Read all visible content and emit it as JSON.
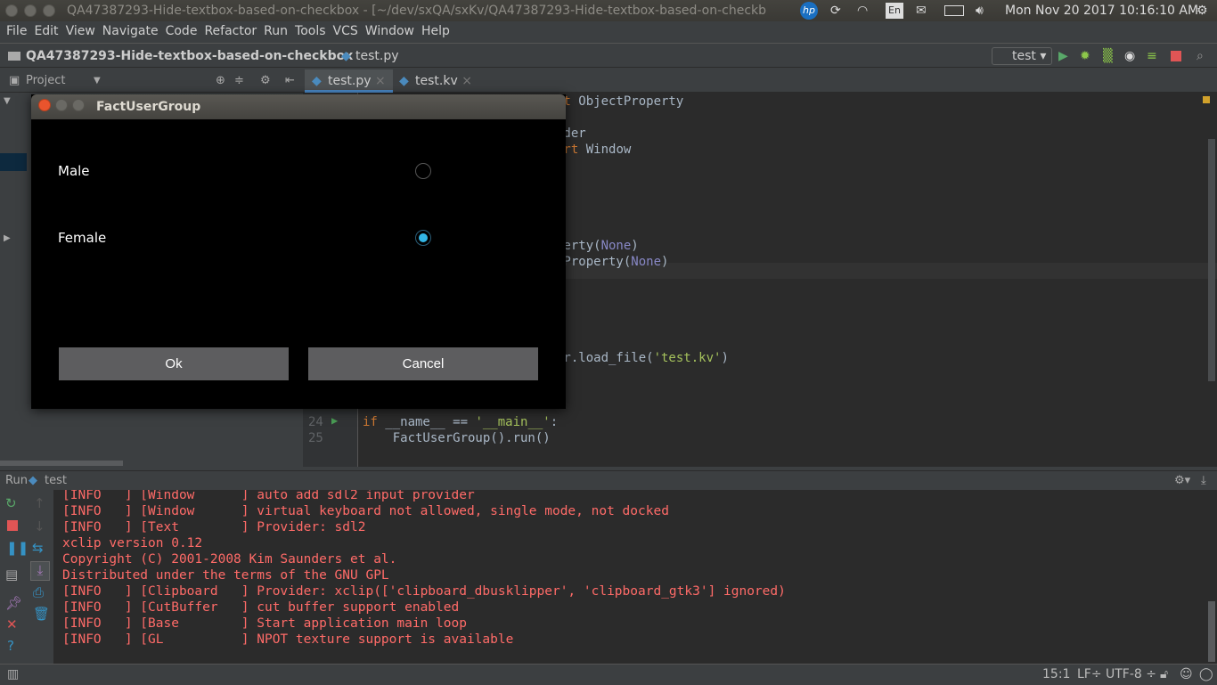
{
  "system": {
    "window_title": "QA47387293-Hide-textbox-based-on-checkbox - [~/dev/sxQA/sxKv/QA47387293-Hide-textbox-based-on-checkb",
    "keyboard": "En",
    "clock": "Mon Nov 20 2017 10:16:10 AM"
  },
  "menu": [
    "File",
    "Edit",
    "View",
    "Navigate",
    "Code",
    "Refactor",
    "Run",
    "Tools",
    "VCS",
    "Window",
    "Help"
  ],
  "nav": {
    "project": "QA47387293-Hide-textbox-based-on-checkbox",
    "file": "test.py",
    "run_config": "test"
  },
  "toolwindow": {
    "project_label": "Project"
  },
  "tabs": [
    {
      "label": "test.py",
      "active": true
    },
    {
      "label": "test.kv",
      "active": false
    }
  ],
  "code": {
    "l1a": "rt",
    "l1b": " ObjectProperty",
    "l2": "lder",
    "l3a": "ort",
    "l3b": " Window",
    "l4a": "perty(",
    "l4b": "None",
    "l4c": ")",
    "l5a": "tProperty(",
    "l5b": "None",
    "l5c": ")",
    "l6a": "er.load_file(",
    "l6b": "'test.kv'",
    "l6c": ")",
    "l24n": "24",
    "l24a": "if",
    "l24b": " __name__ == ",
    "l24c": "'__main__'",
    "l24d": ":",
    "l25n": "25",
    "l25": "    FactUserGroup().run()"
  },
  "dialog": {
    "title": "FactUserGroup",
    "options": [
      {
        "label": "Male",
        "selected": false
      },
      {
        "label": "Female",
        "selected": true
      }
    ],
    "ok": "Ok",
    "cancel": "Cancel",
    "accent": "#33b5e5"
  },
  "run": {
    "label": "Run",
    "config": "test"
  },
  "console": [
    "[INFO   ] [Window      ] auto add sdl2 input provider",
    "[INFO   ] [Window      ] virtual keyboard not allowed, single mode, not docked",
    "[INFO   ] [Text        ] Provider: sdl2",
    "xclip version 0.12",
    "Copyright (C) 2001-2008 Kim Saunders et al.",
    "Distributed under the terms of the GNU GPL",
    "[INFO   ] [Clipboard   ] Provider: xclip(['clipboard_dbusklipper', 'clipboard_gtk3'] ignored)",
    "[INFO   ] [CutBuffer   ] cut buffer support enabled",
    "[INFO   ] [Base        ] Start application main loop",
    "[INFO   ] [GL          ] NPOT texture support is available"
  ],
  "status": {
    "position": "15:1",
    "line_sep": "LF÷",
    "encoding": "UTF-8 ÷"
  }
}
